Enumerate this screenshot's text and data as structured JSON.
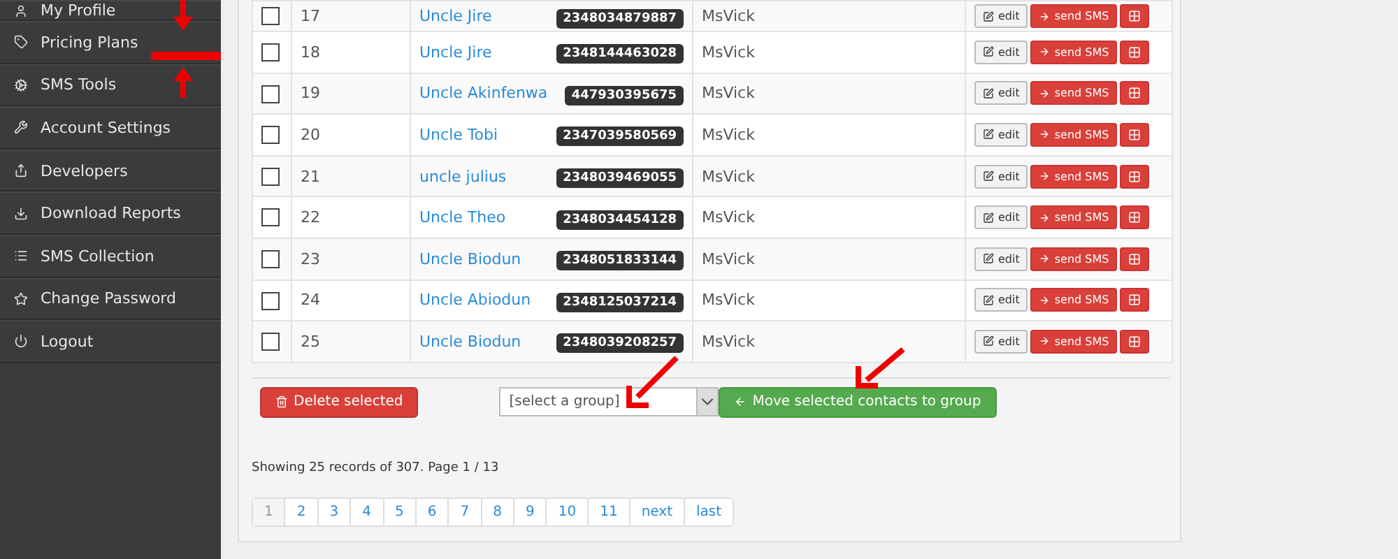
{
  "sidebar": {
    "items": [
      {
        "label": "My Profile"
      },
      {
        "label": "Pricing Plans"
      },
      {
        "label": "SMS Tools"
      },
      {
        "label": "Account Settings"
      },
      {
        "label": "Developers"
      },
      {
        "label": "Download Reports"
      },
      {
        "label": "SMS Collection"
      },
      {
        "label": "Change Password"
      },
      {
        "label": "Logout"
      }
    ]
  },
  "table": {
    "rows": [
      {
        "checked": false,
        "number": "17",
        "name": "Uncle Jire",
        "phone": "2348034879887",
        "owner": "MsVick",
        "edit": "edit",
        "send": "send SMS"
      },
      {
        "checked": false,
        "number": "18",
        "name": "Uncle Jire",
        "phone": "2348144463028",
        "owner": "MsVick",
        "edit": "edit",
        "send": "send SMS"
      },
      {
        "checked": false,
        "number": "19",
        "name": "Uncle Akinfenwa",
        "phone": "447930395675",
        "owner": "MsVick",
        "edit": "edit",
        "send": "send SMS"
      },
      {
        "checked": false,
        "number": "20",
        "name": "Uncle Tobi",
        "phone": "2347039580569",
        "owner": "MsVick",
        "edit": "edit",
        "send": "send SMS"
      },
      {
        "checked": false,
        "number": "21",
        "name": "uncle julius",
        "phone": "2348039469055",
        "owner": "MsVick",
        "edit": "edit",
        "send": "send SMS"
      },
      {
        "checked": false,
        "number": "22",
        "name": "Uncle Theo",
        "phone": "2348034454128",
        "owner": "MsVick",
        "edit": "edit",
        "send": "send SMS"
      },
      {
        "checked": false,
        "number": "23",
        "name": "Uncle Biodun",
        "phone": "2348051833144",
        "owner": "MsVick",
        "edit": "edit",
        "send": "send SMS"
      },
      {
        "checked": false,
        "number": "24",
        "name": "Uncle Abiodun",
        "phone": "2348125037214",
        "owner": "MsVick",
        "edit": "edit",
        "send": "send SMS"
      },
      {
        "checked": false,
        "number": "25",
        "name": "Uncle Biodun",
        "phone": "2348039208257",
        "owner": "MsVick",
        "edit": "edit",
        "send": "send SMS"
      }
    ]
  },
  "delete_button": "Delete selected",
  "group_select": {
    "value": "[select a group]"
  },
  "move_button": "Move selected contacts to group",
  "summary": "Showing 25 records of 307. Page 1 / 13",
  "pagination": [
    {
      "label": "1",
      "selected": true
    },
    {
      "label": "2",
      "selected": false
    },
    {
      "label": "3",
      "selected": false
    },
    {
      "label": "4",
      "selected": false
    },
    {
      "label": "5",
      "selected": false
    },
    {
      "label": "6",
      "selected": false
    },
    {
      "label": "7",
      "selected": false
    },
    {
      "label": "8",
      "selected": false
    },
    {
      "label": "9",
      "selected": false
    },
    {
      "label": "10",
      "selected": false
    },
    {
      "label": "11",
      "selected": false
    },
    {
      "label": "next",
      "selected": false
    },
    {
      "label": "last",
      "selected": false
    }
  ],
  "annotations": [
    {
      "kind": "down"
    },
    {
      "kind": "bar"
    },
    {
      "kind": "up"
    },
    {
      "kind": "diagonal"
    },
    {
      "kind": "diagonal"
    }
  ]
}
